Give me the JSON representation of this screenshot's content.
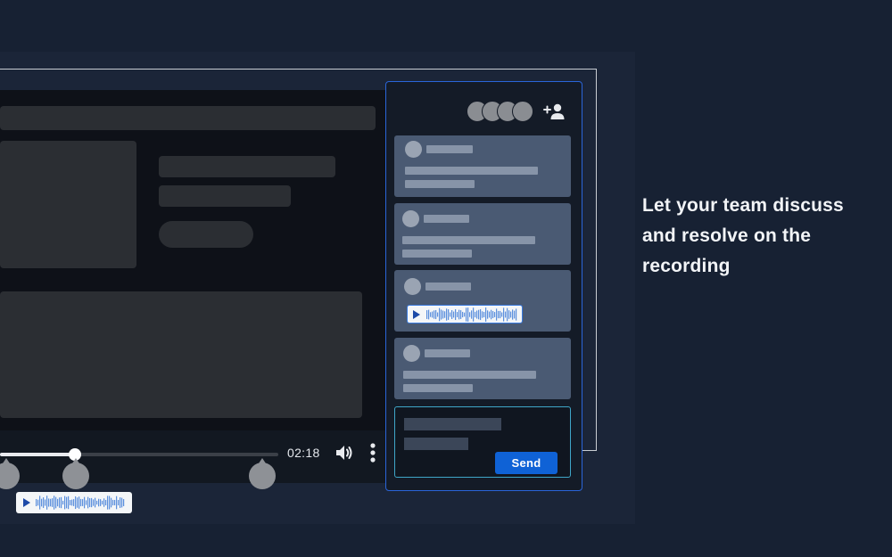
{
  "player": {
    "timestamp": "02:18",
    "progress_fraction": 0.27,
    "controls": {
      "volume_icon": "volume-icon",
      "more_icon": "more-vertical-icon"
    }
  },
  "comments_panel": {
    "participant_count": 4,
    "add_participant_icon": "add-user-icon",
    "composer": {
      "send_label": "Send"
    }
  },
  "headline": {
    "lines": [
      "Let your team discuss",
      "and resolve on the",
      "recording"
    ]
  },
  "colors": {
    "accent": "#0f62d6",
    "panel_border": "#2a65d9",
    "composer_border": "#3fa6c8",
    "background": "#172133",
    "waveform": "#5b8fdd"
  }
}
